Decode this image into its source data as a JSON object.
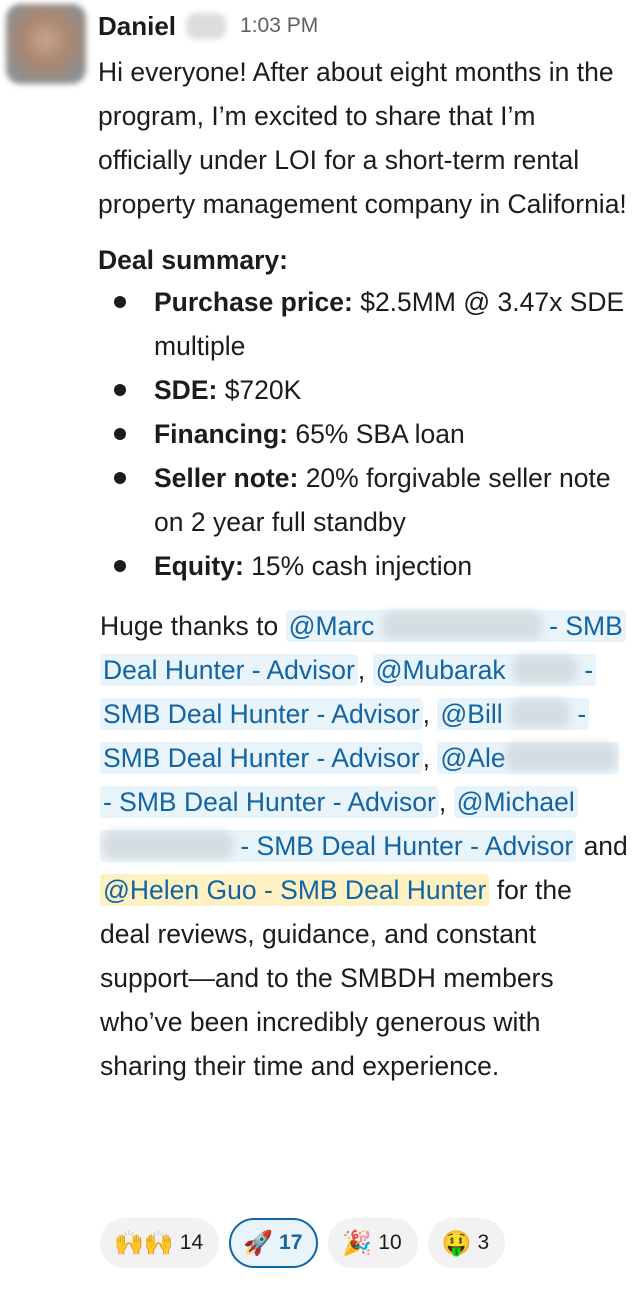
{
  "message": {
    "sender": "Daniel",
    "time": "1:03 PM",
    "intro": "Hi everyone! After about eight months in the program, I’m excited to share that I’m officially under LOI for a short-term rental property management company in California!",
    "summary_title": "Deal summary:",
    "deal_items": [
      {
        "label": "Purchase price:",
        "value": " $2.5MM @ 3.47x SDE multiple"
      },
      {
        "label": "SDE:",
        "value": " $720K"
      },
      {
        "label": "Financing:",
        "value": " 65% SBA loan"
      },
      {
        "label": "Seller note:",
        "value": " 20% forgivable seller note on 2 year full standby"
      },
      {
        "label": "Equity:",
        "value": " 15% cash injection"
      }
    ],
    "thanks_prefix": "Huge thanks to ",
    "mentions": {
      "marc_name": "@Marc",
      "marc_role": " - SMB Deal Hunter - Advisor",
      "mubarak_name": "@Mubarak",
      "mubarak_role": " - SMB Deal Hunter - Advisor",
      "bill_name": "@Bill",
      "bill_role": " - SMB Deal Hunter - Advisor",
      "ale_name": "@Ale",
      "ale_role": " - SMB Deal Hunter - Advisor",
      "michael_name": "@Michael",
      "michael_role": " - SMB Deal Hunter - Advisor",
      "helen": "@Helen Guo - SMB Deal Hunter"
    },
    "sep_comma": ", ",
    "and_text": " and ",
    "thanks_suffix": " for the deal reviews, guidance, and constant support—and to the SMBDH members who’ve been incredibly generous with sharing their time and experience."
  },
  "reactions": [
    {
      "emoji": "🙌🙌",
      "icon": "raised-hands-icon",
      "count": "14",
      "active": false
    },
    {
      "emoji": "🚀",
      "icon": "rocket-icon",
      "count": "17",
      "active": true
    },
    {
      "emoji": "🎉",
      "icon": "party-popper-icon",
      "count": "10",
      "active": false
    },
    {
      "emoji": "🤑",
      "icon": "money-mouth-face-icon",
      "count": "3",
      "active": false
    }
  ],
  "colors": {
    "mention": "#1264a3",
    "mention_bg": "#e8f3fa",
    "self_mention_bg": "#fdf1c4"
  }
}
